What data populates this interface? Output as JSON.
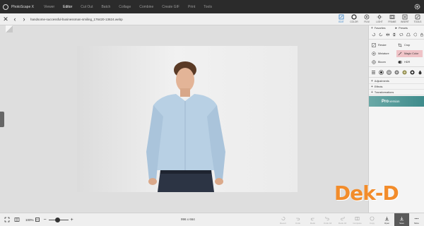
{
  "app": {
    "name": "PhotoScape X"
  },
  "menu": [
    "Viewer",
    "Editor",
    "Cut Out",
    "Batch",
    "Collage",
    "Combine",
    "Create GIF",
    "Print",
    "Tools"
  ],
  "active_menu": "Editor",
  "path": {
    "filename": "handsome-successful-businessman-smiling_176420-13624.webp"
  },
  "tool_tabs": [
    {
      "label": "EDIT",
      "icon": "edit-icon",
      "active": true
    },
    {
      "label": "COLOR",
      "icon": "color-icon"
    },
    {
      "label": "FILM",
      "icon": "film-icon"
    },
    {
      "label": "LIGHT",
      "icon": "light-icon"
    },
    {
      "label": "FRAME",
      "icon": "frame-icon"
    },
    {
      "label": "INSERT",
      "icon": "insert-icon"
    },
    {
      "label": "TOOLS",
      "icon": "tools-icon"
    }
  ],
  "panel": {
    "favorites": "Favorites",
    "presets": "Presets",
    "tools": [
      {
        "label": "Resize",
        "icon": "resize-icon"
      },
      {
        "label": "Crop",
        "icon": "crop-icon"
      },
      {
        "label": "Miniature",
        "icon": "miniature-icon"
      },
      {
        "label": "Magic Color",
        "icon": "magic-color-icon",
        "highlight": true
      },
      {
        "label": "Bloom",
        "icon": "bloom-icon"
      },
      {
        "label": "HDR",
        "icon": "hdr-icon"
      }
    ],
    "sections": [
      "Adjustments",
      "Effects",
      "Transformations"
    ],
    "pro_banner": {
      "word": "Pro",
      "suffix": "version"
    }
  },
  "bottom": {
    "zoom": "100%",
    "zoom_box": "1:1",
    "zoom_level": 0.45,
    "image_size": "996 x 664",
    "actions": [
      {
        "label": "Revert",
        "icon": "revert-icon",
        "enabled": false
      },
      {
        "label": "Undo",
        "icon": "undo-icon",
        "enabled": false
      },
      {
        "label": "Redo",
        "icon": "redo-icon",
        "enabled": false
      },
      {
        "label": "Undo All",
        "icon": "undo-all-icon",
        "enabled": false
      },
      {
        "label": "Redo All",
        "icon": "redo-all-icon",
        "enabled": false
      },
      {
        "label": "Compare",
        "icon": "compare-icon",
        "enabled": false
      },
      {
        "label": "Copy",
        "icon": "copy-icon",
        "enabled": false
      },
      {
        "label": "Open",
        "icon": "open-icon",
        "enabled": true
      },
      {
        "label": "Save",
        "icon": "save-icon",
        "enabled": true
      },
      {
        "label": "More",
        "icon": "more-icon",
        "enabled": true
      }
    ]
  },
  "watermark": "Dek-D",
  "colors": {
    "titlebar": "#2b2b2b",
    "accent": "#2a7cc7",
    "highlight": "#efc3c7",
    "pro": "#3e8b8b",
    "watermark": "#f28c2b"
  }
}
